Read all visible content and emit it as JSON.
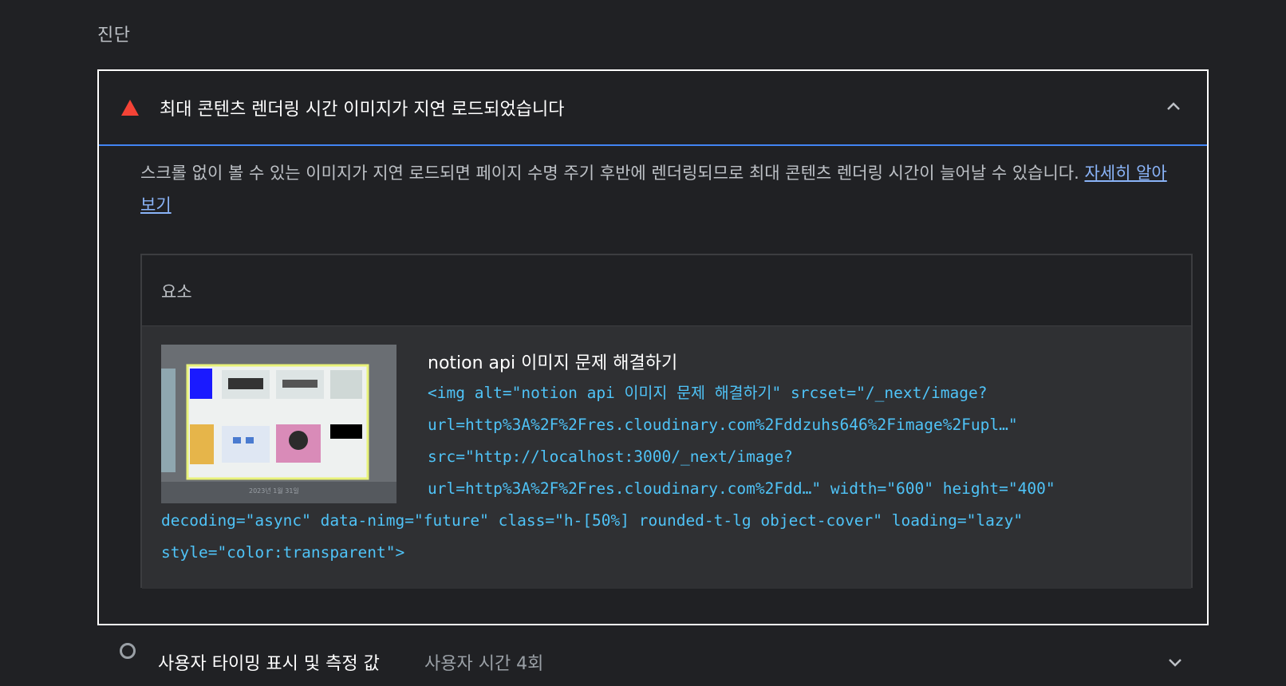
{
  "section": {
    "title": "진단"
  },
  "audit": {
    "title": "최대 콘텐츠 렌더링 시간 이미지가 지연 로드되었습니다",
    "description": "스크롤 없이 볼 수 있는 이미지가 지연 로드되면 페이지 수명 주기 후반에 렌더링되므로 최대 콘텐츠 렌더링 시간이 늘어날 수 있습니다. ",
    "learn_more": "자세히 알아보기",
    "status_color": "#f44336",
    "table": {
      "column_header": "요소",
      "rows": [
        {
          "node_label": "notion api 이미지 문제 해결하기",
          "snippet_lines": [
            "<img alt=\"notion api 이미지 문제 해결하기\" srcset=\"/_next/image?",
            "url=http%3A%2F%2Fres.cloudinary.com%2Fddzuhs646%2Fimage%2Fupl…\"",
            "src=\"http://localhost:3000/_next/image?",
            "url=http%3A%2F%2Fres.cloudinary.com%2Fdd…\" width=\"600\" height=\"400\"",
            "decoding=\"async\" data-nimg=\"future\" class=\"h-[50%] rounded-t-lg object-cover\" loading=\"lazy\"",
            "style=\"color:transparent\">"
          ],
          "thumbnail_caption": "2023년 1월 31일"
        }
      ]
    }
  },
  "next_audit": {
    "title": "사용자 타이밍 표시 및 측정 값",
    "value": "사용자 시간 4회"
  },
  "icons": {
    "fail": "warning-triangle-icon",
    "expand_open": "chevron-up-icon",
    "expand_closed": "chevron-down-icon",
    "info": "info-circle-icon"
  }
}
